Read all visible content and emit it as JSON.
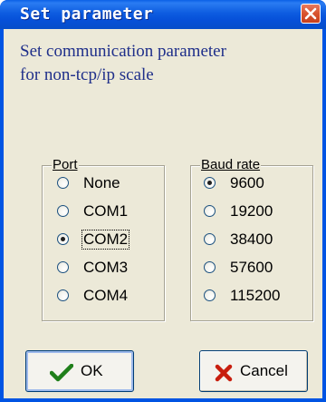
{
  "window": {
    "title": "Set parameter"
  },
  "description": {
    "line1": "Set communication parameter",
    "line2": "for non-tcp/ip scale"
  },
  "port_group": {
    "label": "Port",
    "options": [
      "None",
      "COM1",
      "COM2",
      "COM3",
      "COM4"
    ],
    "selected": "COM2"
  },
  "baud_group": {
    "label": "Baud rate",
    "options": [
      "9600",
      "19200",
      "38400",
      "57600",
      "115200"
    ],
    "selected": "9600"
  },
  "buttons": {
    "ok_label": "OK",
    "cancel_label": "Cancel"
  },
  "icons": {
    "ok": "checkmark-icon",
    "cancel": "x-icon",
    "close": "close-icon"
  },
  "colors": {
    "titlebar": "#0054e3",
    "dialog_bg": "#ece9d8",
    "description_text": "#1f2f8a",
    "ok_check": "#1f7f1a",
    "cancel_x": "#c81e0e",
    "close_button": "#d8532e"
  }
}
